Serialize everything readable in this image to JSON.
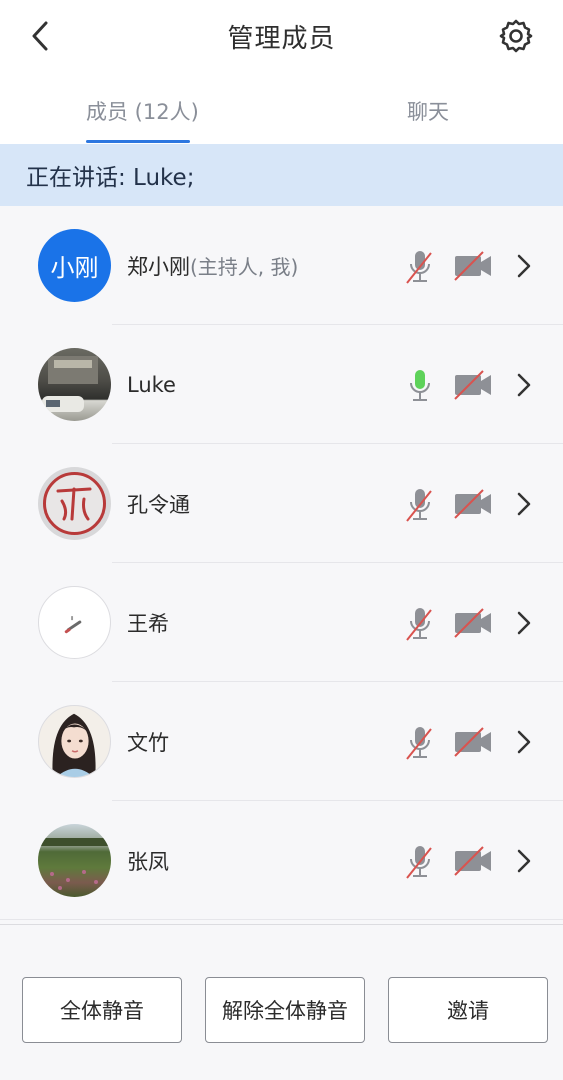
{
  "header": {
    "title": "管理成员"
  },
  "tabs": {
    "members": "成员 (12人)",
    "chat": "聊天"
  },
  "speaking": {
    "text": "正在讲话: Luke;"
  },
  "members": [
    {
      "name": "郑小刚",
      "note": "(主持人, 我)",
      "avatar_text": "小刚",
      "mic": "muted",
      "cam": "off"
    },
    {
      "name": "Luke",
      "note": "",
      "avatar_text": "",
      "mic": "active",
      "cam": "off"
    },
    {
      "name": "孔令通",
      "note": "",
      "avatar_text": "",
      "mic": "muted",
      "cam": "off"
    },
    {
      "name": "王希",
      "note": "",
      "avatar_text": "",
      "mic": "muted",
      "cam": "off"
    },
    {
      "name": "文竹",
      "note": "",
      "avatar_text": "",
      "mic": "muted",
      "cam": "off"
    },
    {
      "name": "张凤",
      "note": "",
      "avatar_text": "",
      "mic": "muted",
      "cam": "off"
    }
  ],
  "footer": {
    "mute_all": "全体静音",
    "unmute_all": "解除全体静音",
    "invite": "邀请"
  },
  "colors": {
    "accent": "#2d77e0",
    "speaking_bg": "#d7e6f8",
    "mic_active": "#5ed25a",
    "muted_slash": "#d9534f",
    "icon_gray": "#8e9096"
  }
}
